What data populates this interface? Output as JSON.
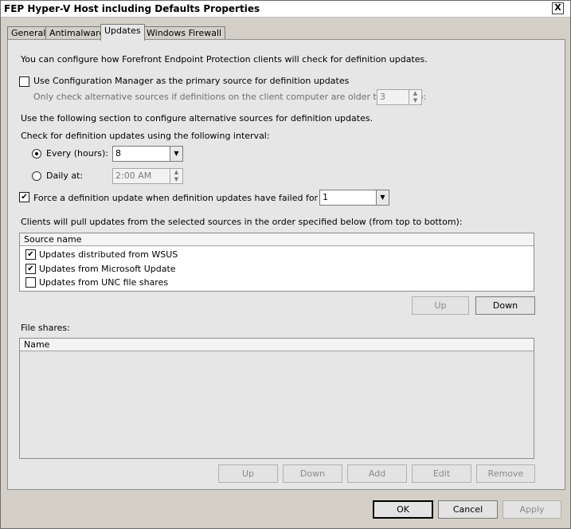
{
  "window": {
    "title": "FEP Hyper-V Host including Defaults Properties",
    "close_label": "X"
  },
  "tabs": [
    {
      "label": "General"
    },
    {
      "label": "Antimalware"
    },
    {
      "label": "Updates"
    },
    {
      "label": "Windows Firewall"
    }
  ],
  "updates": {
    "intro": "You can configure how Forefront Endpoint Protection clients will check for definition updates.",
    "use_config_manager": {
      "label": "Use Configuration Manager as the primary source for definition updates",
      "checked": false
    },
    "alt_sources_label": "Only check alternative sources if definitions on the client computer are older than (days):",
    "alt_sources_days": "3",
    "section_label": "Use the following section to configure alternative sources for definition updates.",
    "interval_label": "Check for definition updates using the following interval:",
    "every_hours": {
      "label": "Every (hours):",
      "value": "8",
      "selected": true
    },
    "daily_at": {
      "label": "Daily at:",
      "value": "2:00 AM",
      "selected": false
    },
    "force_update": {
      "label": "Force a definition update when definition updates have failed for (days):",
      "checked": true,
      "value": "1"
    },
    "order_label": "Clients will pull updates from the selected sources in the order specified below (from top to bottom):",
    "sources": {
      "header": "Source name",
      "items": [
        {
          "label": "Updates distributed from WSUS",
          "checked": true
        },
        {
          "label": "Updates from Microsoft Update",
          "checked": true
        },
        {
          "label": "Updates from UNC file shares",
          "checked": false
        }
      ],
      "up_label": "Up",
      "down_label": "Down"
    },
    "file_shares": {
      "label": "File shares:",
      "header": "Name",
      "up_label": "Up",
      "down_label": "Down",
      "add_label": "Add",
      "edit_label": "Edit",
      "remove_label": "Remove"
    }
  },
  "footer": {
    "ok_label": "OK",
    "cancel_label": "Cancel",
    "apply_label": "Apply"
  }
}
